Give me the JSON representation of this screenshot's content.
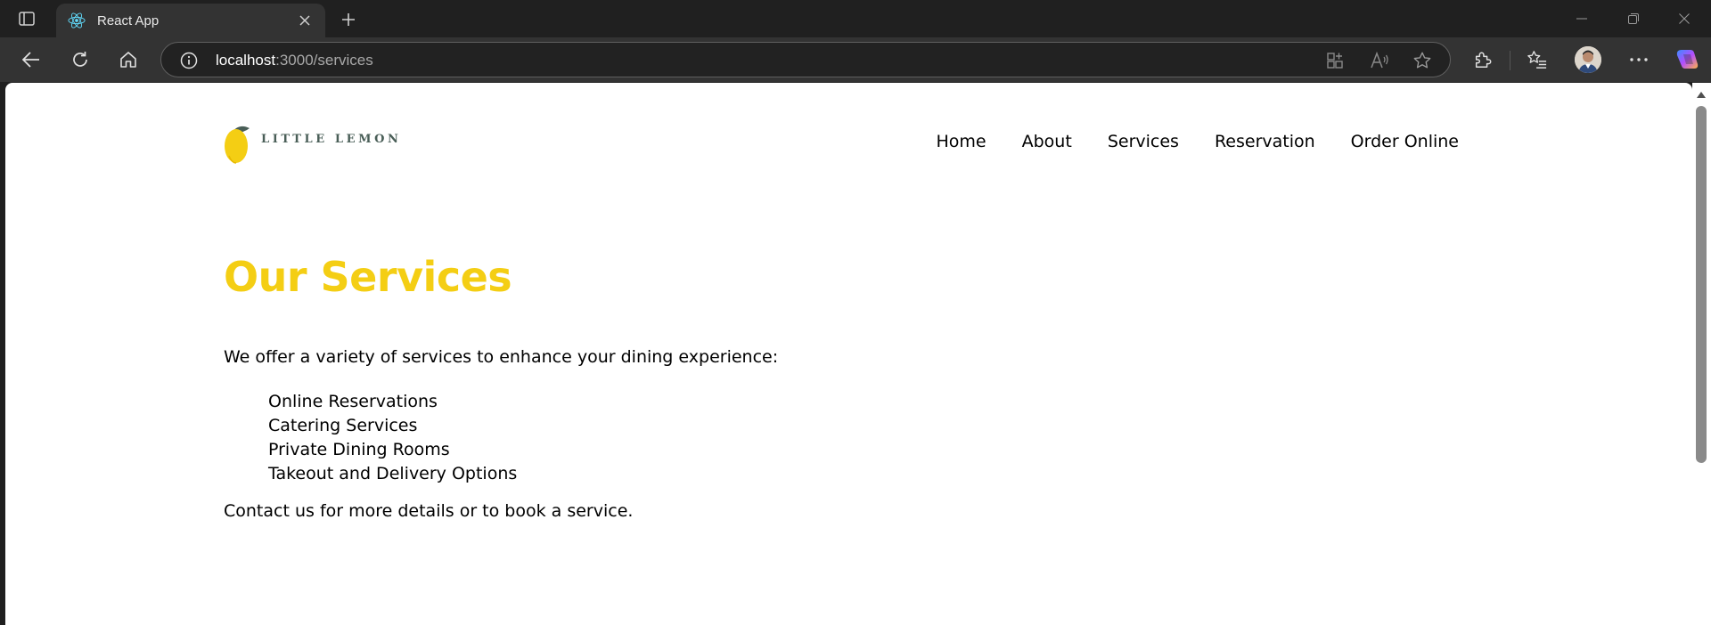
{
  "browser": {
    "tab": {
      "title": "React App",
      "favicon": "react-icon"
    },
    "address": {
      "host": "localhost",
      "path": ":3000/services"
    },
    "icons": {
      "tab_actions": "tab-actions-icon",
      "close": "close-icon",
      "new_tab": "plus-icon",
      "back": "back-arrow-icon",
      "reload": "reload-icon",
      "home": "home-icon",
      "site_info": "info-icon",
      "app_available": "app-grid-icon",
      "read_aloud": "read-aloud-icon",
      "favorite": "star-icon",
      "extensions": "puzzle-icon",
      "favorites": "favorites-list-icon",
      "profile": "avatar",
      "menu": "more-icon",
      "copilot": "copilot-icon",
      "minimize": "minimize-icon",
      "restore": "restore-icon",
      "window_close": "window-close-icon"
    }
  },
  "site": {
    "logo_text": "LITTLE LEMON",
    "nav": [
      "Home",
      "About",
      "Services",
      "Reservation",
      "Order Online"
    ]
  },
  "page": {
    "title": "Our Services",
    "intro": "We offer a variety of services to enhance your dining experience:",
    "services": [
      "Online Reservations",
      "Catering Services",
      "Private Dining Rooms",
      "Takeout and Delivery Options"
    ],
    "outro": "Contact us for more details or to book a service."
  },
  "colors": {
    "accent_yellow": "#F4CE14",
    "logo_green": "#495E57",
    "browser_chrome": "#202020",
    "toolbar": "#333333"
  }
}
